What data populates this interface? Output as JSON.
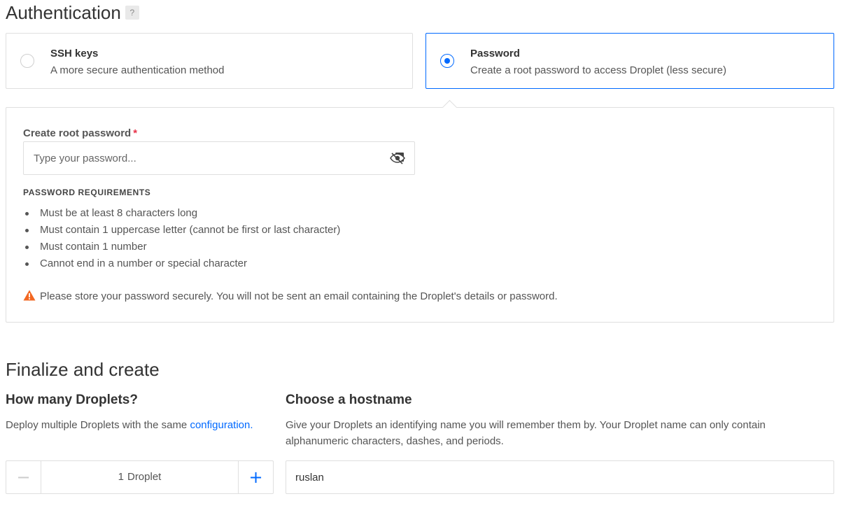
{
  "authentication": {
    "title": "Authentication",
    "help_label": "?",
    "options": [
      {
        "title": "SSH keys",
        "description": "A more secure authentication method",
        "selected": false
      },
      {
        "title": "Password",
        "description": "Create a root password to access Droplet (less secure)",
        "selected": true
      }
    ],
    "password_field": {
      "label": "Create root password",
      "required_mark": "*",
      "placeholder": "Type your password...",
      "value": ""
    },
    "requirements": {
      "heading": "PASSWORD REQUIREMENTS",
      "items": [
        "Must be at least 8 characters long",
        "Must contain 1 uppercase letter (cannot be first or last character)",
        "Must contain 1 number",
        "Cannot end in a number or special character"
      ]
    },
    "warning": "Please store your password securely. You will not be sent an email containing the Droplet's details or password."
  },
  "finalize": {
    "title": "Finalize and create",
    "droplets": {
      "title": "How many Droplets?",
      "description": "Deploy multiple Droplets with the same",
      "link_text": "configuration.",
      "count": "1",
      "unit": "Droplet",
      "minus_label": "−",
      "plus_label": "+"
    },
    "hostname": {
      "title": "Choose a hostname",
      "description": "Give your Droplets an identifying name you will remember them by. Your Droplet name can only contain alphanumeric characters, dashes, and periods.",
      "value": "ruslan"
    }
  },
  "colors": {
    "accent": "#0069ff",
    "warning": "#f26722",
    "required": "#e8334a"
  },
  "icons": {
    "password_toggle": "eye-slash-icon",
    "warning": "warning-triangle-icon"
  }
}
